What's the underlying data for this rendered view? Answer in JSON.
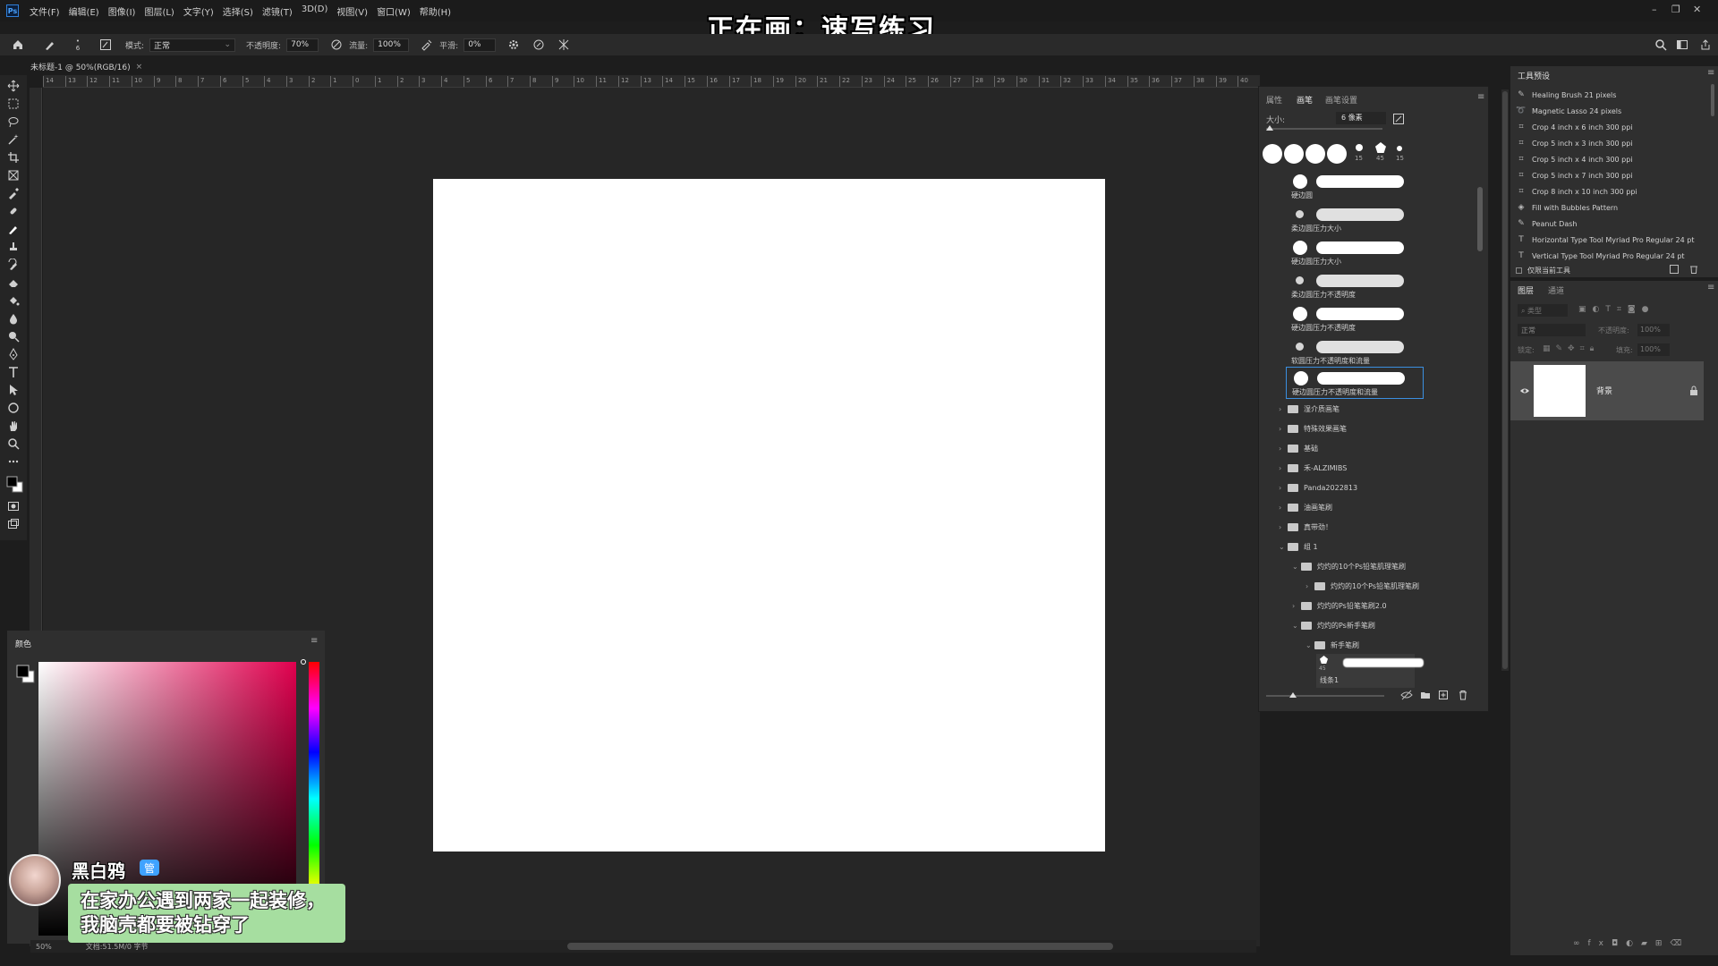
{
  "app": {
    "logo": "Ps"
  },
  "menu": [
    "文件(F)",
    "编辑(E)",
    "图像(I)",
    "图层(L)",
    "文字(Y)",
    "选择(S)",
    "滤镜(T)",
    "3D(D)",
    "视图(V)",
    "窗口(W)",
    "帮助(H)"
  ],
  "overlay_title": "正在画：速写练习",
  "options": {
    "brush_size": "6",
    "mode_label": "模式:",
    "mode_value": "正常",
    "opacity_label": "不透明度:",
    "opacity_value": "70%",
    "flow_label": "流量:",
    "flow_value": "100%",
    "smooth_label": "平滑:",
    "smooth_value": "0%"
  },
  "document_tab": {
    "title": "未标题-1 @ 50%(RGB/16)",
    "close": "×"
  },
  "ruler_labels": [
    "14",
    "13",
    "12",
    "11",
    "10",
    "9",
    "8",
    "7",
    "6",
    "5",
    "4",
    "3",
    "2",
    "1",
    "0",
    "1",
    "2",
    "3",
    "4",
    "5",
    "6",
    "7",
    "8",
    "9",
    "10",
    "11",
    "12",
    "13",
    "14",
    "15",
    "16",
    "17",
    "18",
    "19",
    "20",
    "21",
    "22",
    "23",
    "24",
    "25",
    "26",
    "27",
    "28",
    "29",
    "30",
    "31",
    "32",
    "33",
    "34",
    "35",
    "36",
    "37",
    "38",
    "39",
    "40"
  ],
  "brush_panel": {
    "tabs": [
      "属性",
      "画笔",
      "画笔设置"
    ],
    "size_label": "大小:",
    "size_value": "6 像素",
    "tip_numbers": [
      "15",
      "45",
      "15"
    ],
    "brushes": [
      {
        "name": "硬边圆"
      },
      {
        "name": "柔边圆压力大小"
      },
      {
        "name": "硬边圆压力大小"
      },
      {
        "name": "柔边圆压力不透明度"
      },
      {
        "name": "硬边圆压力不透明度"
      },
      {
        "name": "软圆压力不透明度和流量"
      },
      {
        "name": "硬边圆压力不透明度和流量"
      }
    ],
    "folders": [
      {
        "name": "湿介质画笔",
        "indent": 0
      },
      {
        "name": "特殊效果画笔",
        "indent": 0
      },
      {
        "name": "基础",
        "indent": 0
      },
      {
        "name": "禾-ALZIMIBS",
        "indent": 0
      },
      {
        "name": "Panda2022813",
        "indent": 0
      },
      {
        "name": "油画笔刷",
        "indent": 0
      },
      {
        "name": "真带劲！",
        "indent": 0
      },
      {
        "name": "组 1",
        "indent": 0
      },
      {
        "name": "灼灼的10个Ps铅笔肌理笔刷",
        "indent": 1
      },
      {
        "name": "灼灼的10个Ps铅笔肌理笔刷",
        "indent": 2
      },
      {
        "name": "灼灼的Ps铅笔笔刷2.0",
        "indent": 1
      },
      {
        "name": "灼灼的Ps新手笔刷",
        "indent": 1
      },
      {
        "name": "新手笔刷",
        "indent": 2
      }
    ],
    "last_brush": {
      "size": "45",
      "name": "线条1"
    }
  },
  "presets_panel": {
    "title": "工具预设",
    "items": [
      {
        "icon": "brush-icon",
        "label": "Healing Brush 21 pixels"
      },
      {
        "icon": "lasso-icon",
        "label": "Magnetic Lasso 24 pixels"
      },
      {
        "icon": "crop-icon",
        "label": "Crop 4 inch x 6 inch 300 ppi"
      },
      {
        "icon": "crop-icon",
        "label": "Crop 5 inch x 3 inch 300 ppi"
      },
      {
        "icon": "crop-icon",
        "label": "Crop 5 inch x 4 inch 300 ppi"
      },
      {
        "icon": "crop-icon",
        "label": "Crop 5 inch x 7 inch 300 ppi"
      },
      {
        "icon": "crop-icon",
        "label": "Crop 8 inch x 10 inch 300 ppi"
      },
      {
        "icon": "bucket-icon",
        "label": "Fill with Bubbles Pattern"
      },
      {
        "icon": "brush-icon",
        "label": "Peanut Dash"
      },
      {
        "icon": "type-icon",
        "label": "Horizontal Type Tool Myriad Pro Regular 24 pt"
      },
      {
        "icon": "type-icon",
        "label": "Vertical Type Tool Myriad Pro Regular 24 pt"
      }
    ],
    "current_only": "仅限当前工具"
  },
  "layers_panel": {
    "tabs": [
      "图层",
      "通道"
    ],
    "search_placeholder": "类型",
    "blend": "正常",
    "opacity_label": "不透明度:",
    "opacity_value": "100%",
    "lock_label": "锁定:",
    "fill_label": "填充:",
    "fill_value": "100%",
    "layers": [
      {
        "name": "背景"
      }
    ]
  },
  "color_panel": {
    "title": "颜色",
    "hue_color": "#e0004e"
  },
  "status": {
    "zoom": "50%",
    "doc_info": "文档:51.5M/0 字节"
  },
  "chat": {
    "username": "黑白鸦",
    "badge": "管",
    "message": "在家办公遇到两家一起装修，我脑壳都要被钻穿了"
  }
}
